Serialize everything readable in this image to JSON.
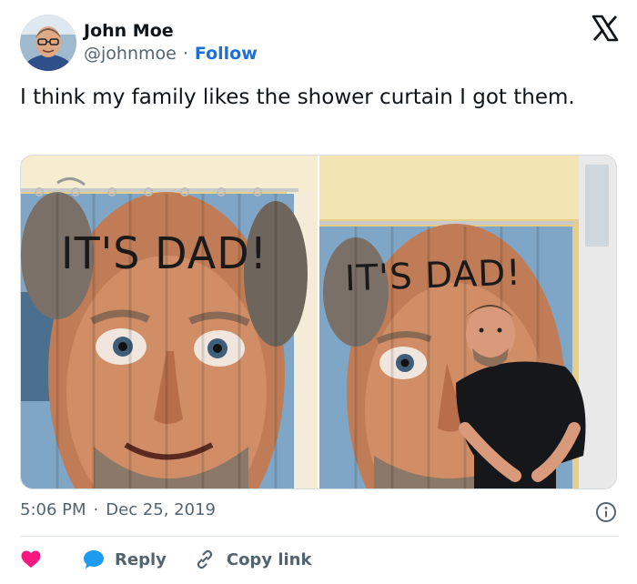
{
  "author": {
    "display_name": "John Moe",
    "handle": "@johnmoe",
    "separator": "·",
    "follow_label": "Follow"
  },
  "tweet": {
    "text": "I think my family likes the shower curtain I got them."
  },
  "media": {
    "left_caption": "IT'S DAD!",
    "right_caption": "IT'S DAD!"
  },
  "meta": {
    "time": "5:06 PM",
    "separator": "·",
    "date": "Dec 25, 2019"
  },
  "actions": {
    "reply_label": "Reply",
    "copy_link_label": "Copy link"
  },
  "icons": {
    "brand": "x-logo-icon",
    "info": "info-icon",
    "like": "heart-icon",
    "reply": "speech-bubble-icon",
    "copy": "link-icon"
  },
  "colors": {
    "follow_blue": "#1d6fd8",
    "reply_blue": "#1d9bf0",
    "heart_pink": "#f91880",
    "muted_text": "#536471",
    "text": "#0f1419"
  }
}
